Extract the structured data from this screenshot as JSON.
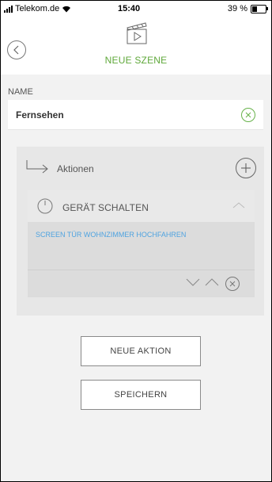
{
  "status_bar": {
    "carrier": "Telekom.de",
    "time": "15:40",
    "battery": "39 %",
    "battery_level": 0.39
  },
  "header": {
    "title": "NEUE SZENE",
    "back_icon": "chevron-left-icon",
    "scene_icon": "clapperboard-play-icon"
  },
  "name_section": {
    "label": "NAME",
    "value": "Fernsehen"
  },
  "actions_section": {
    "label": "Aktionen",
    "items": [
      {
        "title": "GERÄT SCHALTEN",
        "description": "SCREEN TÜR WOHNZIMMER HOCHFAHREN"
      }
    ]
  },
  "buttons": {
    "new_action": "NEUE AKTION",
    "save": "SPEICHERN"
  },
  "colors": {
    "accent_green": "#5fa83a",
    "link_blue": "#4fa3e0",
    "panel_gray": "#e7e7e7"
  }
}
